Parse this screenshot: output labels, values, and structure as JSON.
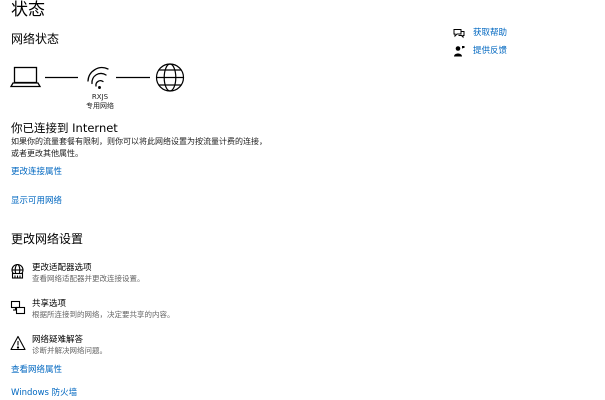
{
  "page": {
    "title": "状态",
    "subtitle": "网络状态"
  },
  "network": {
    "name": "RXJS",
    "type": "专用网络",
    "status_heading": "你已连接到 Internet",
    "status_desc": "如果你的流量套餐有限制，则你可以将此网络设置为按流量计费的连接，或者更改其他属性。"
  },
  "links": {
    "change_connection_props": "更改连接属性",
    "show_available_networks": "显示可用网络",
    "view_network_props": "查看网络属性",
    "windows_firewall": "Windows 防火墙"
  },
  "change_settings": {
    "heading": "更改网络设置",
    "items": [
      {
        "title": "更改适配器选项",
        "desc": "查看网络适配器并更改连接设置。",
        "icon": "adapter-icon"
      },
      {
        "title": "共享选项",
        "desc": "根据所连接到的网络，决定要共享的内容。",
        "icon": "sharing-icon"
      },
      {
        "title": "网络疑难解答",
        "desc": "诊断并解决网络问题。",
        "icon": "warning-icon"
      }
    ]
  },
  "help": {
    "get_help": "获取帮助",
    "give_feedback": "提供反馈"
  }
}
